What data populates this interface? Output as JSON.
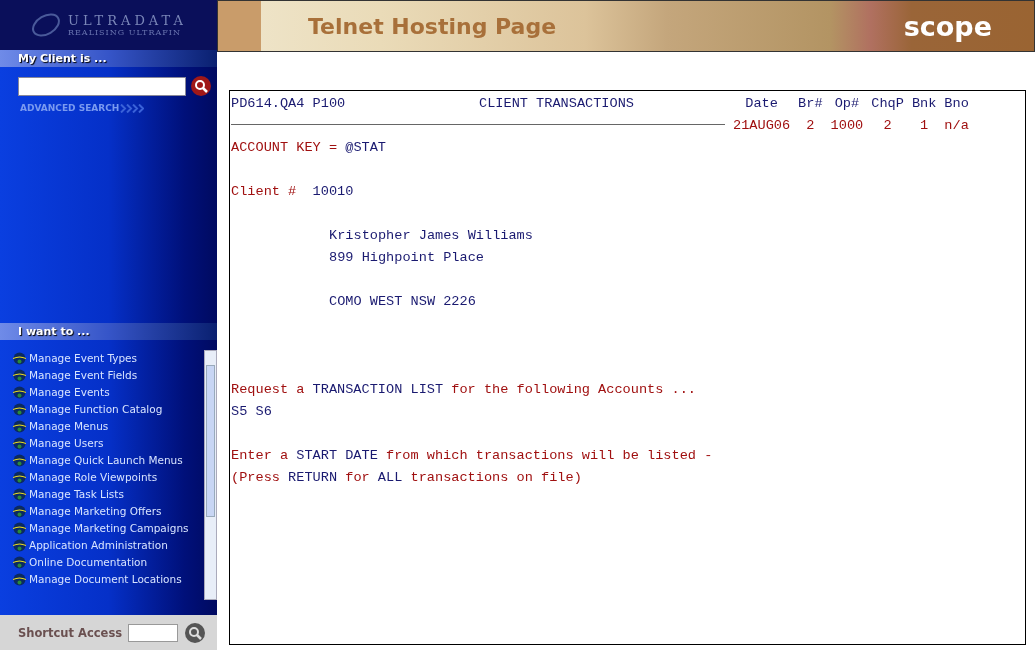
{
  "sidebar": {
    "logo": {
      "name": "ULTRADATA",
      "tagline": "REALISING ULTRAFIN"
    },
    "client_section": {
      "title": "My Client is ...",
      "advanced_link": "ADVANCED SEARCH"
    },
    "tasks_section": {
      "title": "I want to ...",
      "items": [
        {
          "label": "Manage Event Types"
        },
        {
          "label": "Manage Event Fields"
        },
        {
          "label": "Manage Events"
        },
        {
          "label": "Manage Function Catalog"
        },
        {
          "label": "Manage Menus"
        },
        {
          "label": "Manage Users"
        },
        {
          "label": "Manage Quick Launch Menus"
        },
        {
          "label": "Manage Role Viewpoints"
        },
        {
          "label": "Manage Task Lists"
        },
        {
          "label": "Manage Marketing Offers"
        },
        {
          "label": "Manage Marketing Campaigns"
        },
        {
          "label": "Application Administration"
        },
        {
          "label": "Online Documentation"
        },
        {
          "label": "Manage Document Locations"
        }
      ]
    },
    "shortcut": {
      "label": "Shortcut Access"
    }
  },
  "banner": {
    "title": "Telnet Hosting Page",
    "brand": "scope"
  },
  "terminal": {
    "program": "PD614.QA4 P100",
    "title": "CLIENT TRANSACTIONS",
    "columns": [
      {
        "heading": "Date",
        "value": "21AUG06"
      },
      {
        "heading": "Br#",
        "value": "2"
      },
      {
        "heading": "Op#",
        "value": "1000"
      },
      {
        "heading": "ChqP",
        "value": "2"
      },
      {
        "heading": "Bnk",
        "value": "1"
      },
      {
        "heading": "Bno",
        "value": "n/a"
      }
    ],
    "blocks": [
      {
        "kind": "header",
        "lines": [
          [
            {
              "kind": "label",
              "text": "ACCOUNT KEY = "
            },
            {
              "kind": "value",
              "text": "@STAT"
            }
          ]
        ]
      },
      {
        "kind": "field",
        "lines": [
          [
            {
              "kind": "label",
              "text": "Client #  "
            },
            {
              "kind": "value",
              "text": "10010"
            }
          ]
        ]
      },
      {
        "kind": "address",
        "lines": [
          [
            {
              "kind": "value",
              "text": "Kristopher James Williams"
            }
          ],
          [
            {
              "kind": "value",
              "text": "899 Highpoint Place"
            }
          ]
        ]
      },
      {
        "kind": "address",
        "lines": [
          [
            {
              "kind": "value",
              "text": "COMO WEST NSW 2226"
            }
          ]
        ]
      },
      {
        "kind": "prompt",
        "lines": [
          [
            {
              "kind": "label",
              "text": "Request a "
            },
            {
              "kind": "value",
              "text": "TRANSACTION LIST"
            },
            {
              "kind": "label",
              "text": " for the following Accounts ..."
            }
          ],
          [
            {
              "kind": "value",
              "text": "S5 S6"
            }
          ]
        ]
      },
      {
        "kind": "field",
        "lines": [
          [
            {
              "kind": "label",
              "text": "Enter a "
            },
            {
              "kind": "value",
              "text": "START DATE"
            },
            {
              "kind": "label",
              "text": " from which transactions will be listed -"
            }
          ],
          [
            {
              "kind": "label",
              "text": "(Press "
            },
            {
              "kind": "value",
              "text": "RETURN"
            },
            {
              "kind": "label",
              "text": " for "
            },
            {
              "kind": "value",
              "text": "ALL"
            },
            {
              "kind": "label",
              "text": " transactions on file)"
            }
          ]
        ]
      }
    ]
  }
}
